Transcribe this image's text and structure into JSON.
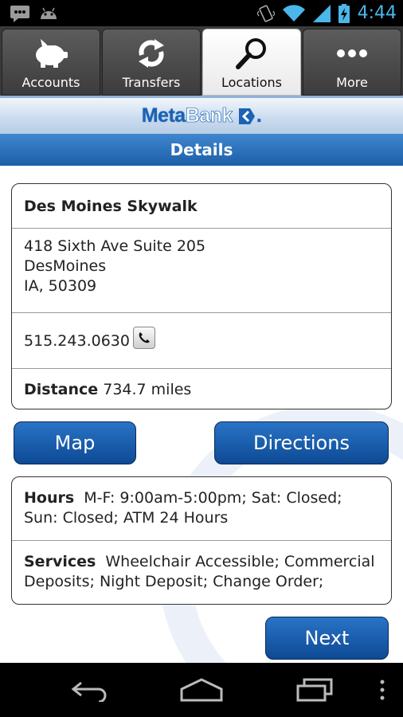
{
  "status_bar": {
    "time": "4:44",
    "icons": [
      "message-icon",
      "android-icon",
      "vibrate-icon",
      "wifi-icon",
      "signal-icon",
      "battery-charging-icon"
    ]
  },
  "tabs": [
    {
      "label": "Accounts",
      "icon": "piggy-bank-icon",
      "active": false
    },
    {
      "label": "Transfers",
      "icon": "refresh-arrows-icon",
      "active": false
    },
    {
      "label": "Locations",
      "icon": "magnifier-icon",
      "active": true
    },
    {
      "label": "More",
      "icon": "more-dots-icon",
      "active": false
    }
  ],
  "header": {
    "brand_meta": "Meta",
    "brand_bank": "Bank",
    "brand_suffix": ".",
    "page_title": "Details"
  },
  "location": {
    "name": "Des Moines Skywalk",
    "address_line1": "418 Sixth Ave Suite 205",
    "address_line2": "DesMoines",
    "address_line3": "IA, 50309",
    "phone": "515.243.0630",
    "distance_label": "Distance",
    "distance_value": "734.7 miles",
    "hours_label": "Hours",
    "hours_value": "M-F: 9:00am-5:00pm; Sat: Closed; Sun: Closed; ATM 24 Hours",
    "services_label": "Services",
    "services_value": "Wheelchair Accessible; Commercial Deposits; Night Deposit; Change Order;"
  },
  "buttons": {
    "map": "Map",
    "directions": "Directions",
    "next": "Next"
  },
  "colors": {
    "accent_blue": "#1a63b5",
    "clock_blue": "#4bb6ea",
    "button_blue": "#1358a8"
  }
}
